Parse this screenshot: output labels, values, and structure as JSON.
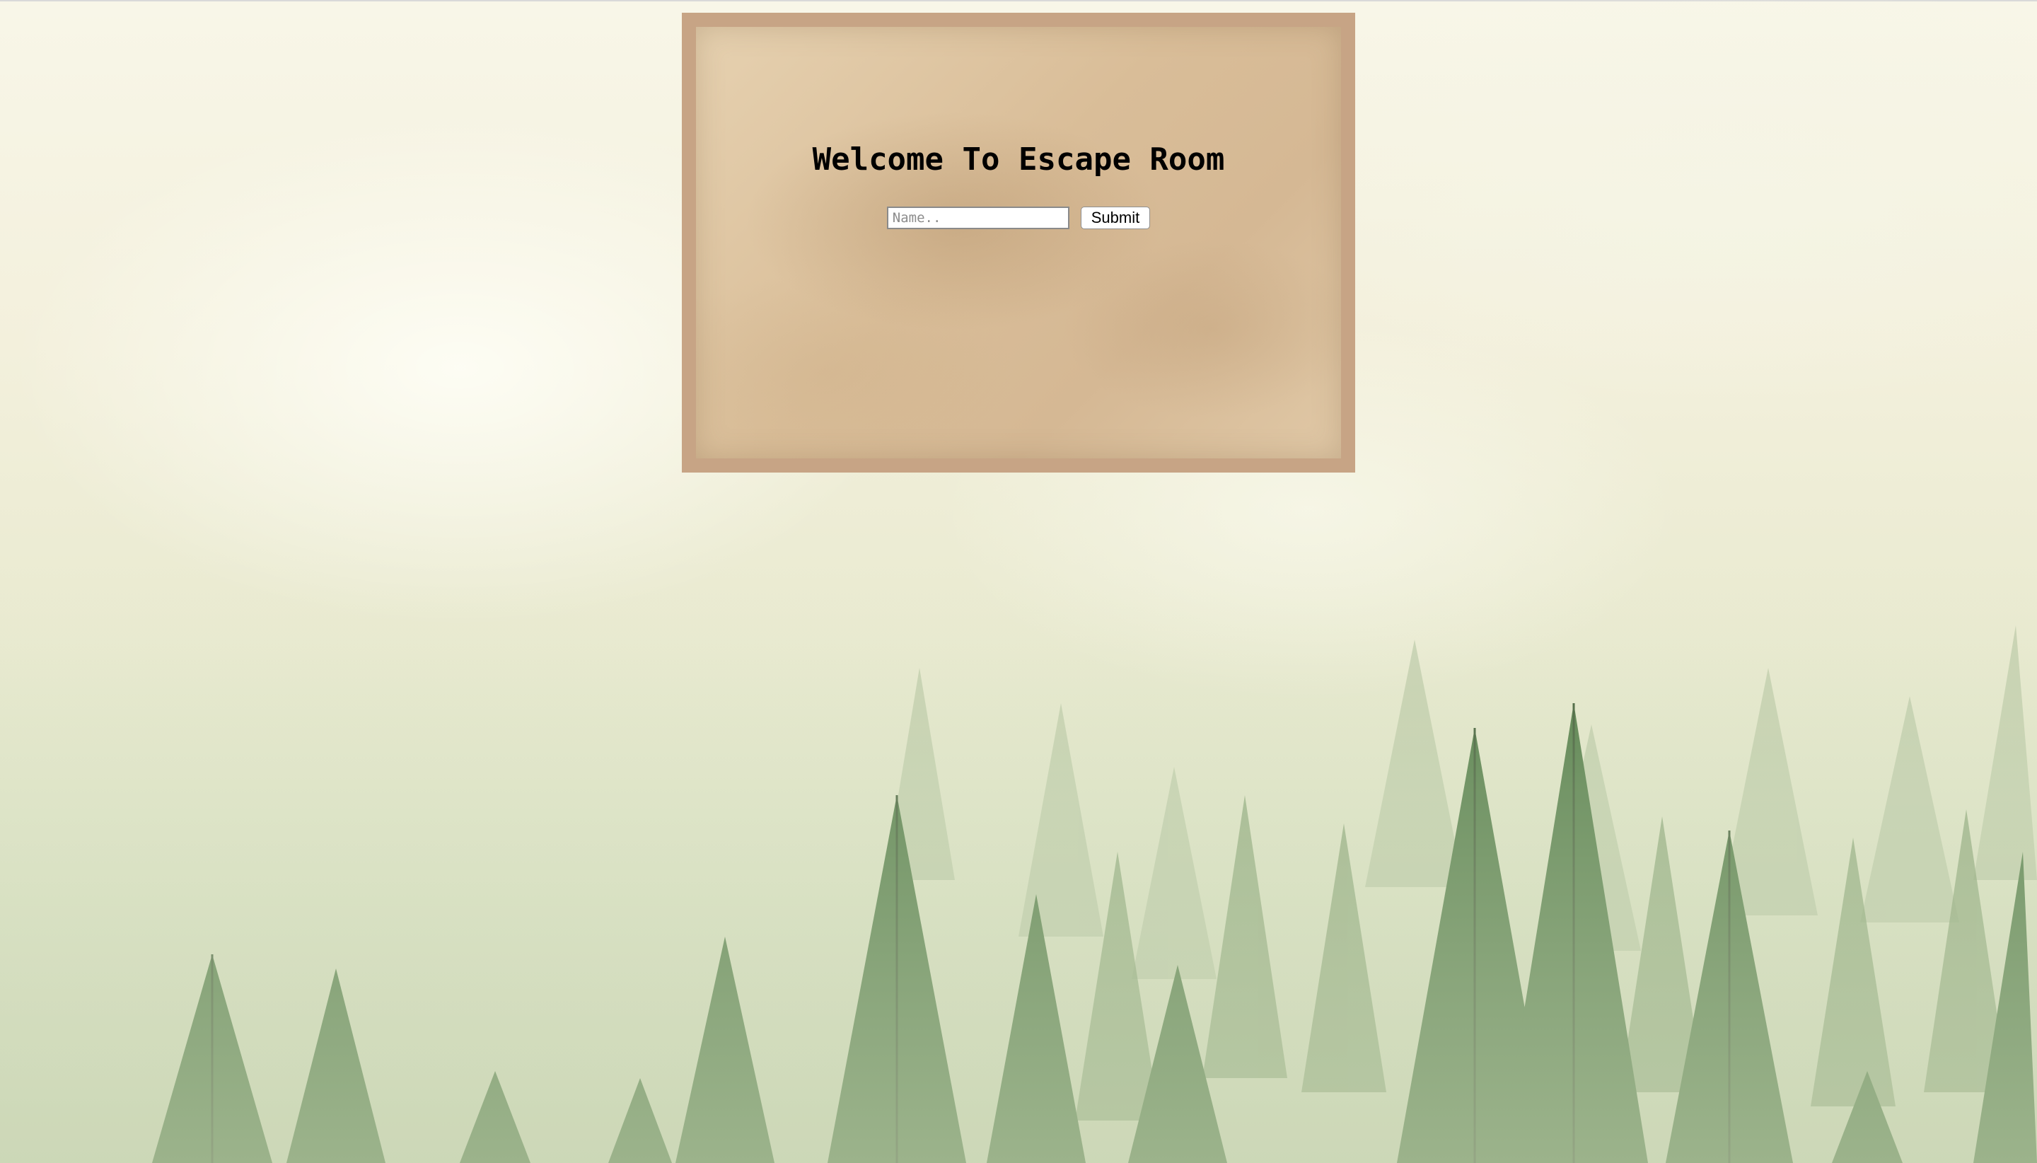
{
  "page": {
    "title": "Welcome To Escape Room"
  },
  "form": {
    "name_placeholder": "Name..",
    "name_value": "",
    "submit_label": "Submit"
  },
  "colors": {
    "panel_border": "#c7a485",
    "panel_paper": "#dcc29f",
    "forest_green": "#4f7a45",
    "mist": "#f8f6e8"
  }
}
